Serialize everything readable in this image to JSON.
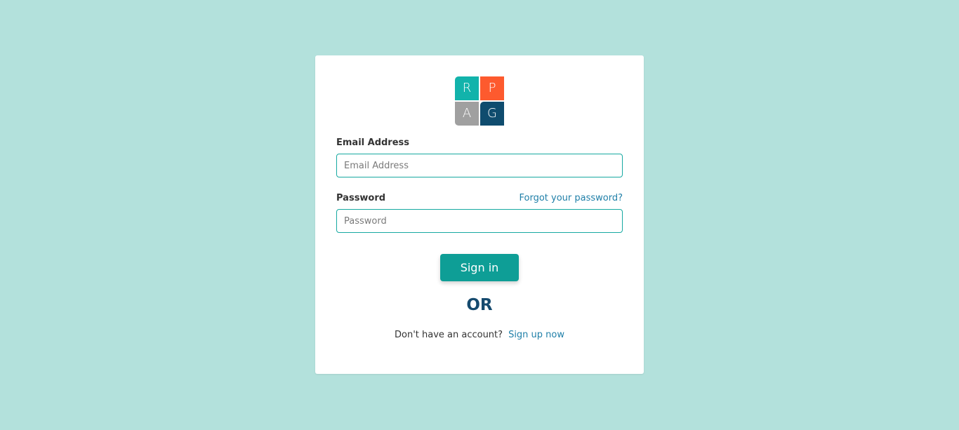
{
  "logo": {
    "tiles": [
      {
        "letter": "R",
        "color": "#12b3ab"
      },
      {
        "letter": "P",
        "color": "#fd5a2e"
      },
      {
        "letter": "A",
        "color": "#a0a0a0"
      },
      {
        "letter": "G",
        "color": "#0f4c6e"
      }
    ]
  },
  "email": {
    "label": "Email Address",
    "placeholder": "Email Address",
    "value": ""
  },
  "password": {
    "label": "Password",
    "placeholder": "Password",
    "value": "",
    "forgot_link": "Forgot your password?"
  },
  "signin_button": "Sign in",
  "or_text": "OR",
  "signup": {
    "prompt": "Don't have an account?",
    "link": "Sign up now"
  },
  "colors": {
    "background": "#b3e1dc",
    "accent": "#0e9e96",
    "link": "#1f7fa8",
    "heading": "#154a6e"
  }
}
